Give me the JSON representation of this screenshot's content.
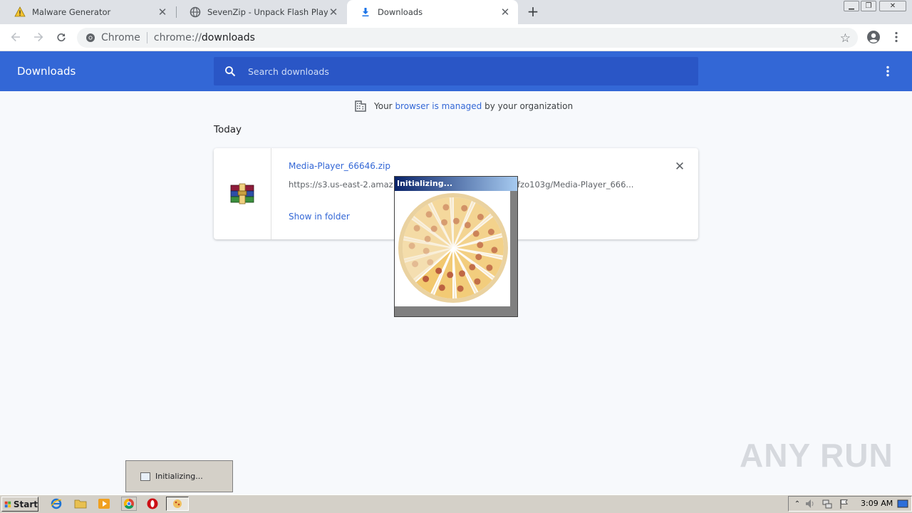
{
  "tabs": [
    {
      "title": "Malware Generator",
      "favicon": "warning-icon",
      "active": false
    },
    {
      "title": "SevenZip - Unpack Flash Player",
      "favicon": "globe-icon",
      "active": false
    },
    {
      "title": "Downloads",
      "favicon": "download-icon",
      "active": true
    }
  ],
  "omnibox": {
    "scheme_label": "Chrome",
    "url_prefix": "chrome://",
    "url_host": "downloads"
  },
  "header": {
    "title": "Downloads",
    "search_placeholder": "Search downloads"
  },
  "managed": {
    "pre": "Your ",
    "link": "browser is managed",
    "post": " by your organization"
  },
  "section": {
    "date": "Today"
  },
  "download": {
    "filename": "Media-Player_66646.zip",
    "url": "https://s3.us-east-2.amaz                                            ykfzo103g/Media-Player_666...",
    "action": "Show in folder"
  },
  "splash": {
    "title": "Initializing..."
  },
  "taskbar_popup": {
    "label": "Initializing..."
  },
  "watermark": "ANY RUN",
  "taskbar": {
    "start_label": "Start",
    "clock": "3:09 AM"
  },
  "colors": {
    "header_blue": "#3367d6",
    "search_blue": "#2a56c6",
    "link_blue": "#3367d6"
  }
}
